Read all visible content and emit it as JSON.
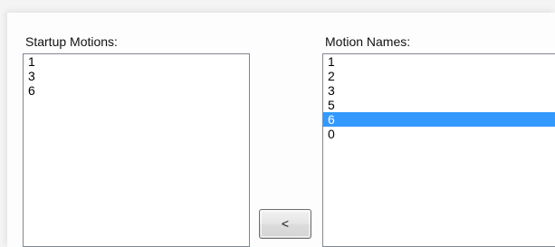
{
  "startup": {
    "label": "Startup Motions:",
    "items": [
      "1",
      "3",
      "6"
    ]
  },
  "names": {
    "label": "Motion Names:",
    "items": [
      "1",
      "2",
      "3",
      "5",
      "6",
      "0"
    ],
    "selected_index": 4
  },
  "move_button": {
    "label": "<"
  },
  "colors": {
    "selection": "#3399ff",
    "list_border": "#828790"
  }
}
